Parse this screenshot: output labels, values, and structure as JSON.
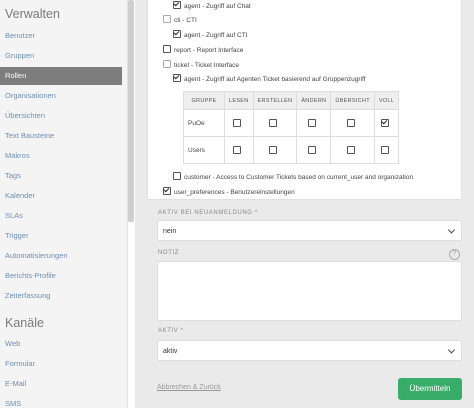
{
  "sidebar": {
    "manage_heading": "Verwalten",
    "items": [
      "Benutzer",
      "Gruppen",
      "Rollen",
      "Organisationen",
      "Übersichten",
      "Text Bausteine",
      "Makros",
      "Tags",
      "Kalender",
      "SLAs",
      "Trigger",
      "Automatisierungen",
      "Berichts-Profile",
      "Zeiterfassung"
    ],
    "active_item": "Rollen",
    "channels_heading": "Kanäle",
    "channel_items": [
      "Web",
      "Formular",
      "E-Mail",
      "SMS"
    ]
  },
  "permissions": {
    "agent_chat": "agent - Zugriff auf Chat",
    "cti": "cti - CTI",
    "agent_cti": "agent - Zugriff auf CTI",
    "report": "report - Report Interface",
    "ticket": "ticket - Ticket Interface",
    "agent_ticket_group": "agent - Zugriff auf Agenten Ticket basierend auf Gruppenzugriff",
    "customer": "customer - Access to Customer Tickets based on current_user and organization",
    "user_preferences": "user_preferences - Benutzereinstellungen"
  },
  "group_table": {
    "headers": [
      "GRUPPE",
      "LESEN",
      "ERSTELLEN",
      "ÄNDERN",
      "ÜBERSICHT",
      "VOLL"
    ],
    "rows": [
      {
        "group": "PuOe",
        "values": [
          false,
          false,
          false,
          false,
          true
        ]
      },
      {
        "group": "Users",
        "values": [
          false,
          false,
          false,
          false,
          false
        ]
      }
    ]
  },
  "form": {
    "active_new_reg_label": "AKTIV BEI NEUANMELDUNG *",
    "active_new_reg_value": "nein",
    "note_label": "NOTIZ",
    "note_help": "?",
    "active_label": "AKTIV *",
    "active_value": "aktiv",
    "cancel_label": "Abbrechen & Zurück",
    "submit_label": "Übermitteln"
  },
  "colors": {
    "submit": "#38ad69",
    "link": "#6c8fb3",
    "active_nav": "#7d7d7d"
  }
}
